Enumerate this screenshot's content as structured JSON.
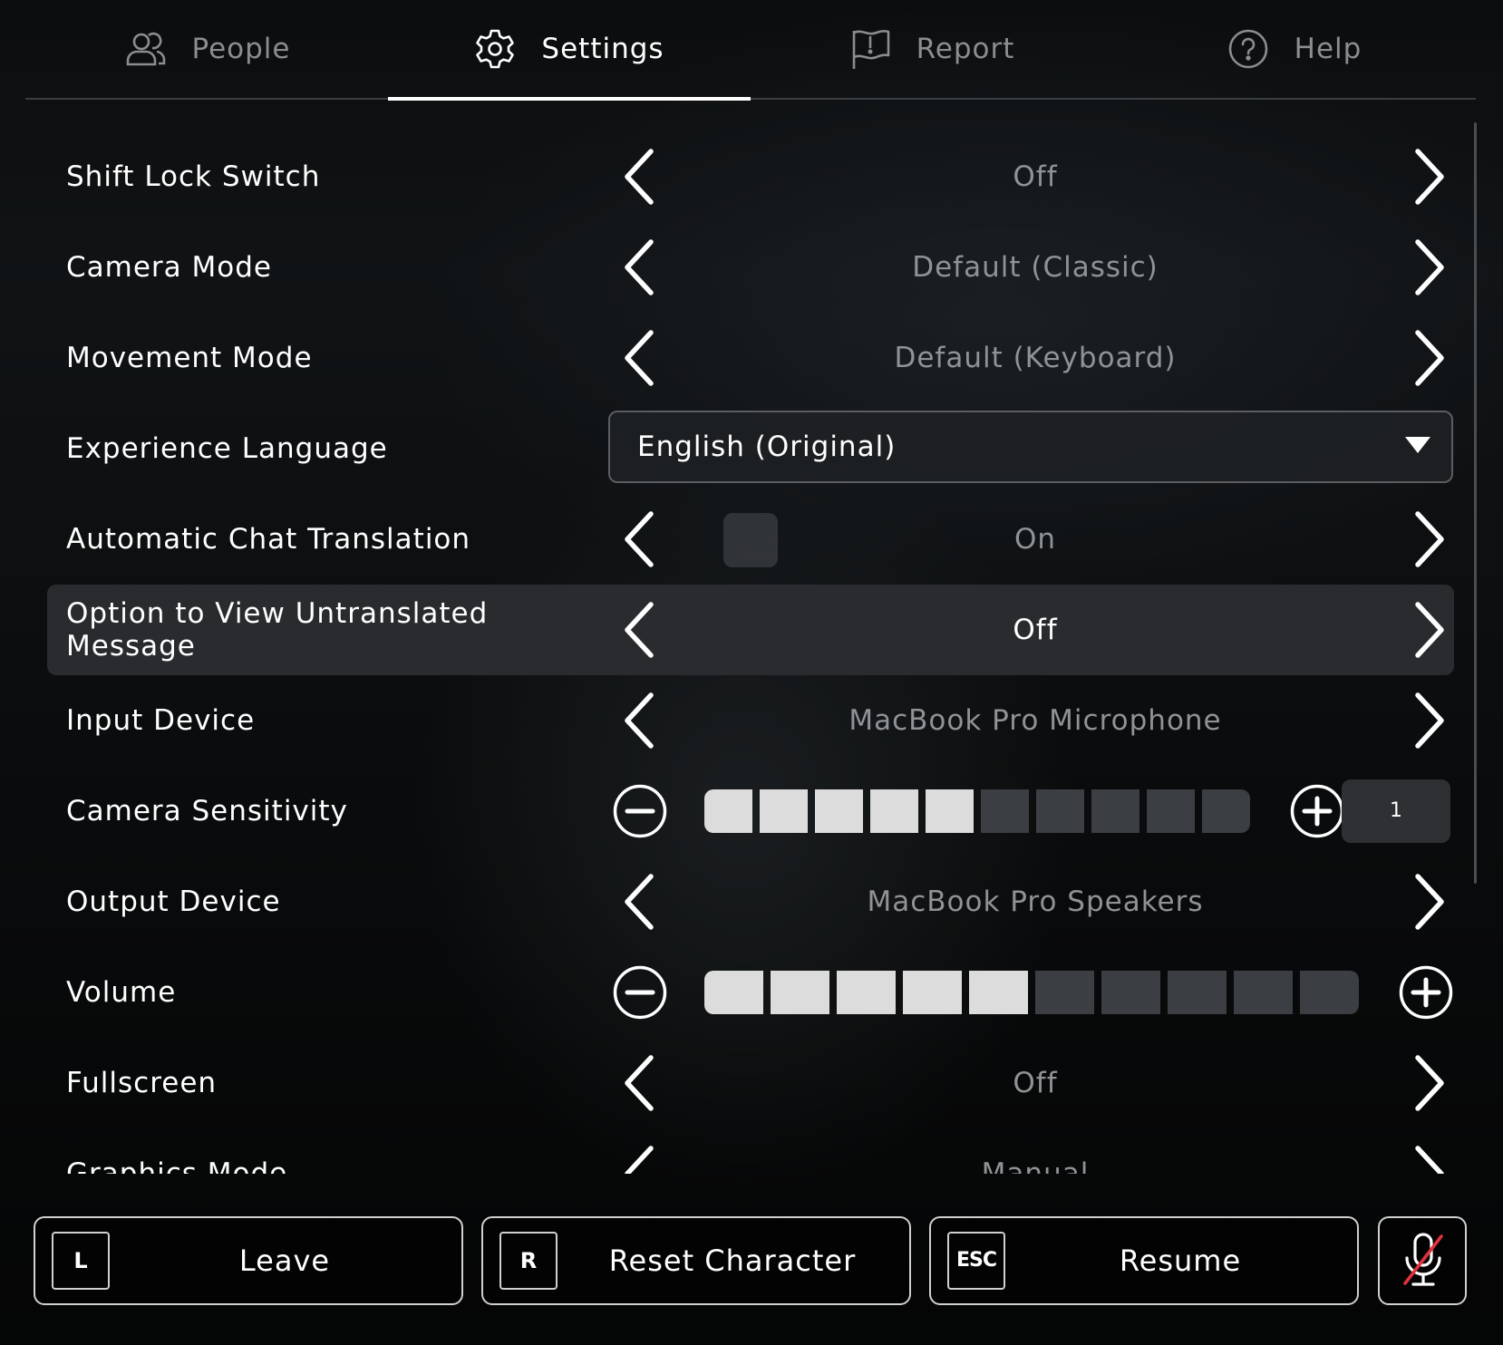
{
  "tabs": [
    {
      "label": "People",
      "icon": "people-icon",
      "active": false
    },
    {
      "label": "Settings",
      "icon": "gear-icon",
      "active": true
    },
    {
      "label": "Report",
      "icon": "flag-icon",
      "active": false
    },
    {
      "label": "Help",
      "icon": "help-icon",
      "active": false
    }
  ],
  "settings": {
    "shift_lock": {
      "label": "Shift Lock Switch",
      "value": "Off"
    },
    "camera_mode": {
      "label": "Camera Mode",
      "value": "Default (Classic)"
    },
    "movement_mode": {
      "label": "Movement Mode",
      "value": "Default (Keyboard)"
    },
    "experience_language": {
      "label": "Experience Language",
      "value": "English (Original)"
    },
    "auto_chat_translation": {
      "label": "Automatic Chat Translation",
      "value": "On"
    },
    "view_untranslated": {
      "label_line1": "Option to View Untranslated",
      "label_line2": "Message",
      "value": "Off"
    },
    "input_device": {
      "label": "Input Device",
      "value": "MacBook Pro Microphone"
    },
    "camera_sensitivity": {
      "label": "Camera Sensitivity",
      "level": 5,
      "max": 10,
      "number": "1"
    },
    "output_device": {
      "label": "Output Device",
      "value": "MacBook Pro Speakers"
    },
    "volume": {
      "label": "Volume",
      "level": 5,
      "max": 10
    },
    "fullscreen": {
      "label": "Fullscreen",
      "value": "Off"
    },
    "graphics_mode": {
      "label": "Graphics Mode",
      "value": "Manual"
    }
  },
  "bottom_bar": {
    "leave": {
      "key": "L",
      "label": "Leave"
    },
    "reset": {
      "key": "R",
      "label": "Reset Character"
    },
    "resume": {
      "key": "ESC",
      "label": "Resume"
    },
    "mic": {
      "icon": "mic-muted-icon"
    }
  },
  "colors": {
    "accent": "#ffffff",
    "muted_text": "#8f9296",
    "slider_on": "#dcdcdc",
    "slider_off": "#3b3e42",
    "mute_slash": "#e0323c"
  }
}
